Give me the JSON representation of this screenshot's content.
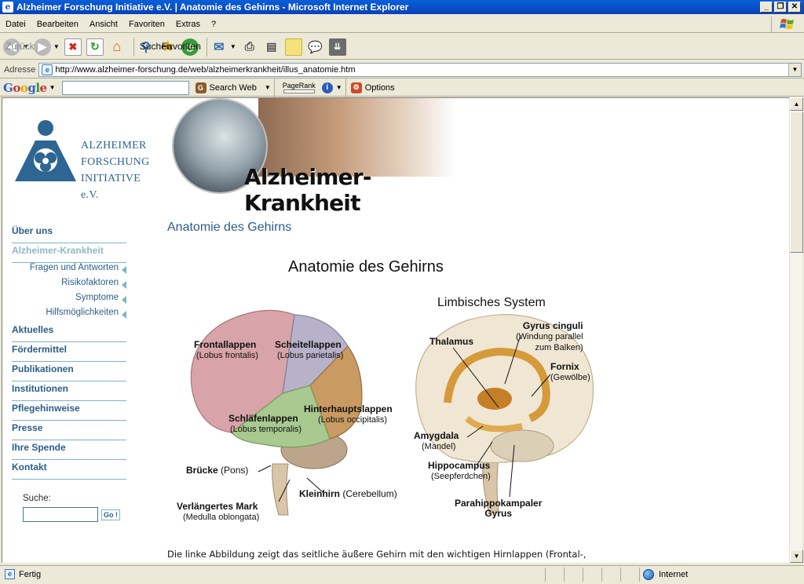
{
  "window": {
    "title": "Alzheimer Forschung Initiative e.V. | Anatomie des Gehirns - Microsoft Internet Explorer"
  },
  "menu": [
    "Datei",
    "Bearbeiten",
    "Ansicht",
    "Favoriten",
    "Extras",
    "?"
  ],
  "toolbar": {
    "back": "Zurück",
    "search": "Suchen",
    "favorites": "Favoriten"
  },
  "address": {
    "label": "Adresse",
    "url": "http://www.alzheimer-forschung.de/web/alzheimerkrankheit/illus_anatomie.htm"
  },
  "googlebar": {
    "logo": "Google",
    "search_web": "Search Web",
    "pagerank": "PageRank",
    "options": "Options"
  },
  "site": {
    "logo_lines": [
      "ALZHEIMER",
      "FORSCHUNG",
      "INITIATIVE e.V."
    ],
    "banner_title": "Alzheimer-Krankheit",
    "nav": [
      {
        "label": "Über uns",
        "type": "main"
      },
      {
        "label": "Alzheimer-Krankheit",
        "type": "main-active"
      },
      {
        "label": "Fragen und Antworten",
        "type": "sub"
      },
      {
        "label": "Risikofaktoren",
        "type": "sub"
      },
      {
        "label": "Symptome",
        "type": "sub"
      },
      {
        "label": "Hilfsmöglichkeiten",
        "type": "sub"
      },
      {
        "label": "Aktuelles",
        "type": "main"
      },
      {
        "label": "Fördermittel",
        "type": "main"
      },
      {
        "label": "Publikationen",
        "type": "main"
      },
      {
        "label": "Institutionen",
        "type": "main"
      },
      {
        "label": "Pflegehinweise",
        "type": "main"
      },
      {
        "label": "Presse",
        "type": "main"
      },
      {
        "label": "Ihre Spende",
        "type": "main"
      },
      {
        "label": "Kontakt",
        "type": "main"
      }
    ],
    "search_label": "Suche:",
    "search_value": "",
    "search_button": "Go !",
    "page_title": "Anatomie des Gehirns",
    "figure": {
      "title": "Anatomie des Gehirns",
      "limbic_title": "Limbisches System",
      "left_labels": {
        "frontal": "Frontallappen",
        "frontal_latin": "(Lobus frontalis)",
        "parietal": "Scheitellappen",
        "parietal_latin": "(Lobus parietalis)",
        "occipital": "Hinterhauptslappen",
        "occipital_latin": "(Lobus occipitalis)",
        "temporal": "Schläfenlappen",
        "temporal_latin": "(Lobus temporalis)",
        "pons": "Brücke",
        "pons_latin": "(Pons)",
        "cerebellum": "Kleinhirn",
        "cerebellum_latin": "(Cerebellum)",
        "medulla": "Verlängertes Mark",
        "medulla_latin": "(Medulla oblongata)"
      },
      "right_labels": {
        "gyrus_cinguli": "Gyrus cinguli",
        "gyrus_cinguli_1": "(Windung parallel",
        "gyrus_cinguli_2": "zum Balken)",
        "thalamus": "Thalamus",
        "fornix": "Fornix",
        "fornix_latin": "(Gewölbe)",
        "amygdala": "Amygdala",
        "amygdala_latin": "(Mandel)",
        "hippocampus": "Hippocampus",
        "hippocampus_latin": "(Seepferdchen)",
        "parahippo_1": "Parahippokampaler",
        "parahippo_2": "Gyrus"
      }
    },
    "body_text": "Die linke Abbildung zeigt das seitliche äußere Gehirn mit den wichtigen Hirnlappen (Frontal-,"
  },
  "status": {
    "text": "Fertig",
    "zone": "Internet"
  },
  "colors": {
    "accent": "#2b5d88",
    "nav_line": "#7fb4c4",
    "titlebar": "#0a5fd9"
  }
}
